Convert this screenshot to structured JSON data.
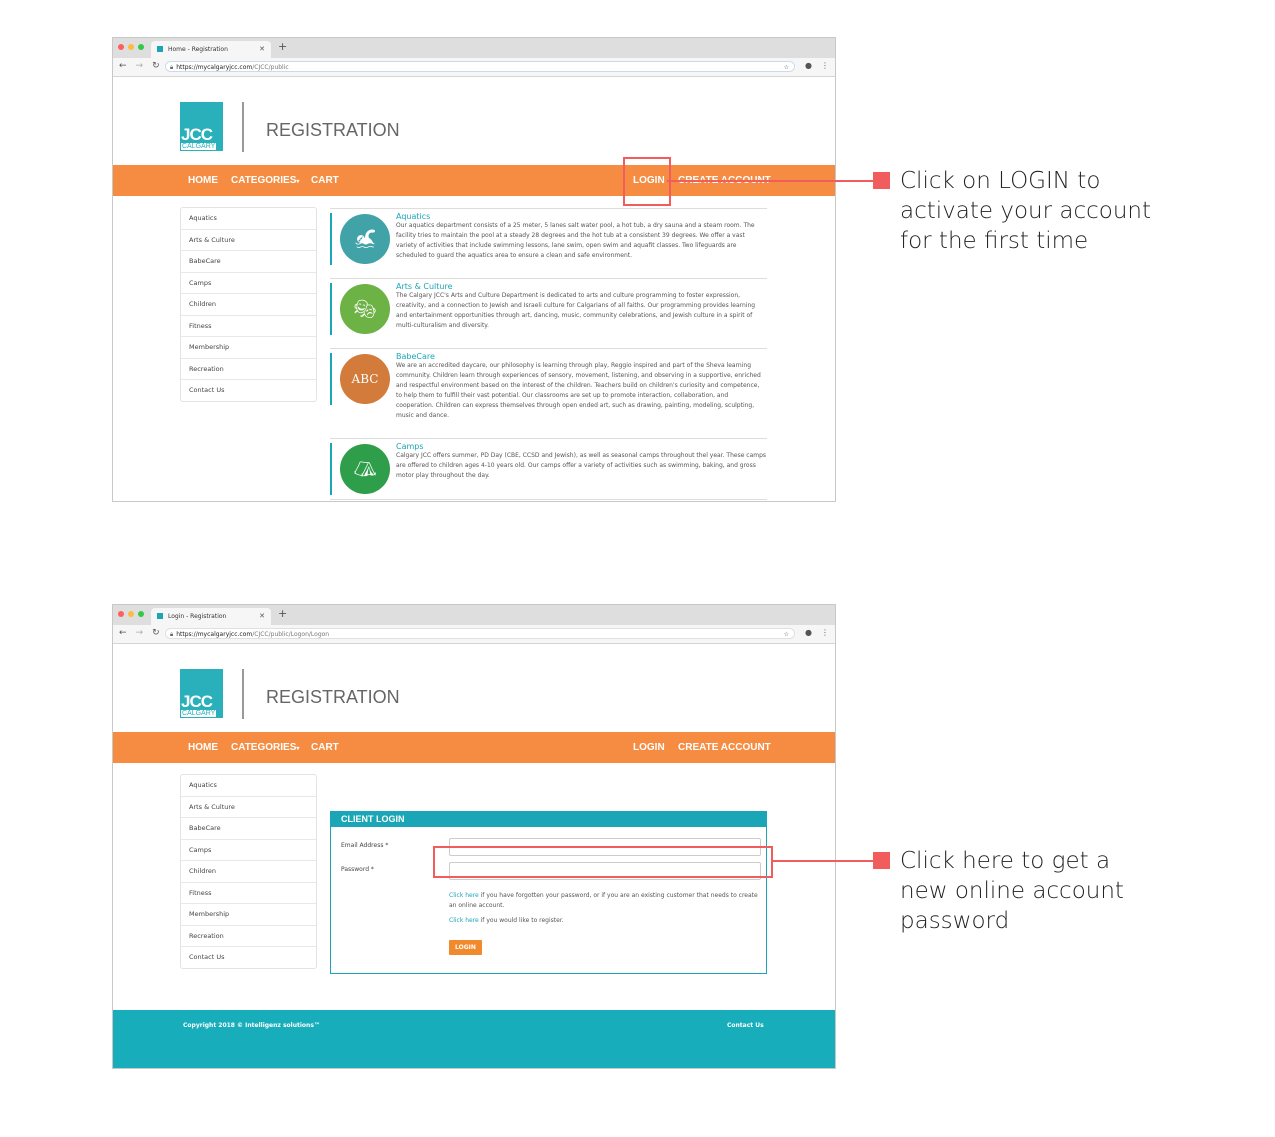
{
  "colors": {
    "brand_orange": "#f58c42",
    "brand_teal": "#1aa6b7",
    "callout_red": "#f15d5d"
  },
  "screen1": {
    "browser": {
      "tab_title": "Home - Registration",
      "url_host": "https://mycalgaryjcc.com",
      "url_path": "/CJCC/public"
    },
    "logo": {
      "main": "JCC",
      "sub": "CALGARY"
    },
    "header_title": "REGISTRATION",
    "nav": {
      "home": "HOME",
      "categories": "CATEGORIES",
      "cart": "CART",
      "login": "LOGIN",
      "create_account": "CREATE ACCOUNT"
    },
    "sidebar": [
      "Aquatics",
      "Arts & Culture",
      "BabeCare",
      "Camps",
      "Children",
      "Fitness",
      "Membership",
      "Recreation",
      "Contact Us"
    ],
    "categories": [
      {
        "name": "Aquatics",
        "icon": "swimmer-icon",
        "description": "Our aquatics department consists of a 25 meter, 5 lanes salt water pool, a hot tub, a dry sauna and a steam room. The facility tries to maintain the pool at a steady 28 degrees and the hot tub at a consistent 39 degrees. We offer a vast variety of activities that include swimming lessons, lane swim, open swim and aquafit classes. Two lifeguards are scheduled to guard the aquatics area to ensure a clean and safe environment."
      },
      {
        "name": "Arts & Culture",
        "icon": "theatre-masks-icon",
        "description": "The Calgary JCC's Arts and Culture Department is dedicated to arts and culture programming to foster expression, creativity, and a connection to Jewish and Israeli culture for Calgarians of all faiths. Our programming provides learning and entertainment opportunities through art, dancing, music, community celebrations, and Jewish culture in a spirit of multi-culturalism and diversity."
      },
      {
        "name": "BabeCare",
        "icon": "abc-blocks-icon",
        "description": "We are an accredited daycare, our philosophy is learning through play, Reggio inspired and part of the Sheva learning community. Children learn through experiences of sensory, movement, listening, and observing in a supportive, enriched and respectful environment based on the interest of the children. Teachers build on children's curiosity and competence, to help them to fulfill their vast potential. Our classrooms are set up to promote interaction, collaboration, and cooperation. Children can express themselves through open ended art, such as drawing, painting, modeling, sculpting, music and dance."
      },
      {
        "name": "Camps",
        "icon": "tent-icon",
        "description": "Calgary JCC offers summer, PD Day (CBE, CCSD and Jewish), as well as seasonal camps throughout thel year. These camps are offered to children ages 4-10 years old. Our camps offer a variety of activities such as swimming, baking, and gross motor play throughout the day."
      }
    ],
    "callout": "Click on LOGIN to activate your account for the first time"
  },
  "screen2": {
    "browser": {
      "tab_title": "Login - Registration",
      "url_host": "https://mycalgaryjcc.com",
      "url_path": "/CJCC/public/Logon/Logon"
    },
    "logo": {
      "main": "JCC",
      "sub": "CALGARY"
    },
    "header_title": "REGISTRATION",
    "nav": {
      "home": "HOME",
      "categories": "CATEGORIES",
      "cart": "CART",
      "login": "LOGIN",
      "create_account": "CREATE ACCOUNT"
    },
    "sidebar": [
      "Aquatics",
      "Arts & Culture",
      "BabeCare",
      "Camps",
      "Children",
      "Fitness",
      "Membership",
      "Recreation",
      "Contact Us"
    ],
    "login": {
      "title": "CLIENT LOGIN",
      "email_label": "Email Address *",
      "email_value": "",
      "password_label": "Password *",
      "password_value": "",
      "forgot_link": "Click here",
      "forgot_text": " if you have forgotten your password, or if you are an existing customer that needs to create an online account.",
      "register_link": "Click here",
      "register_text": " if you would like to register.",
      "button": "LOGIN"
    },
    "footer": {
      "copyright": "Copyright 2018 © Intelligenz solutions™",
      "contact": "Contact Us"
    },
    "callout": "Click here to get a new online account password"
  }
}
